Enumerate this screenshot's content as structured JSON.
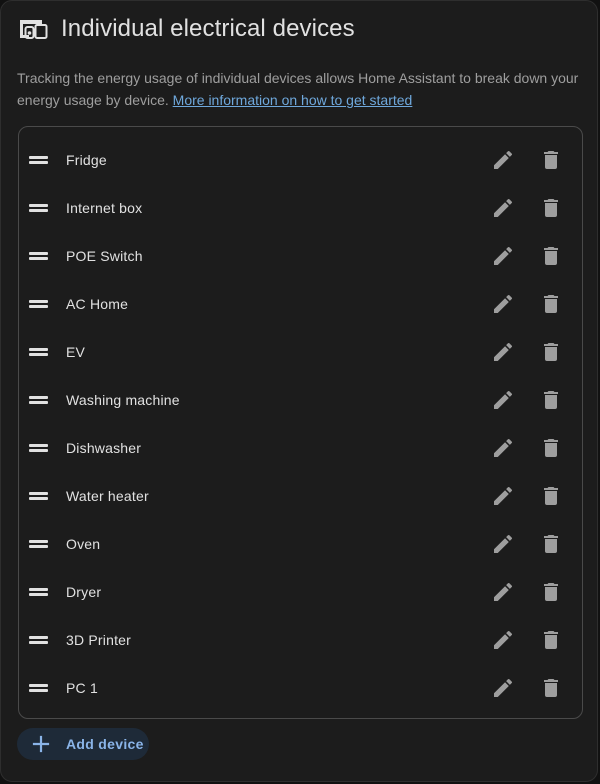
{
  "header": {
    "title": "Individual electrical devices",
    "icon": "devices-icon"
  },
  "description": {
    "text": "Tracking the energy usage of individual devices allows Home Assistant to break down your energy usage by device. ",
    "link": "More information on how to get started"
  },
  "devices": [
    {
      "label": "Fridge"
    },
    {
      "label": "Internet box"
    },
    {
      "label": "POE Switch"
    },
    {
      "label": "AC Home"
    },
    {
      "label": "EV"
    },
    {
      "label": "Washing machine"
    },
    {
      "label": "Dishwasher"
    },
    {
      "label": "Water heater"
    },
    {
      "label": "Oven"
    },
    {
      "label": "Dryer"
    },
    {
      "label": "3D Printer"
    },
    {
      "label": "PC 1"
    }
  ],
  "add_button": {
    "label": "Add device",
    "icon": "plus-icon"
  },
  "colors": {
    "background": "#1c1c1c",
    "text": "#e1e1e1",
    "muted": "#9e9e9e",
    "link": "#6fa8dc",
    "icon": "#9e9e9e",
    "accent": "#8ab4e8",
    "button_bg": "#1e2a38"
  }
}
